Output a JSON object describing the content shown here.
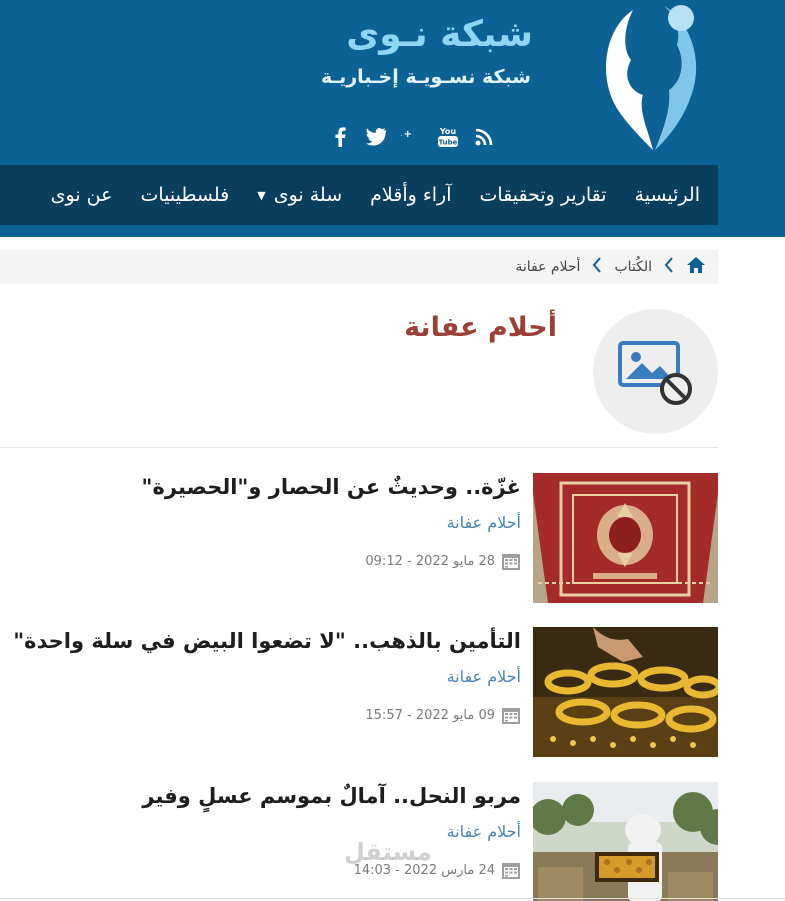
{
  "header": {
    "brand_title": "شبكة نـوى",
    "brand_subtitle": "شبكة نسـويـة إخـباريـة",
    "social": [
      {
        "icon": "rss-icon"
      },
      {
        "icon": "youtube-icon",
        "label": "You Tube"
      },
      {
        "icon": "google-plus-icon",
        "label": "g+"
      },
      {
        "icon": "twitter-icon"
      },
      {
        "icon": "facebook-icon",
        "label": "f"
      }
    ]
  },
  "nav": {
    "items": [
      "الرئيسية",
      "تقارير وتحقيقات",
      "آراء وأقلام",
      "سلة نوى",
      "فلسطينيات",
      "عن نوى"
    ]
  },
  "breadcrumb": {
    "level1": "الكُتاب",
    "level2": "أحلام عفانة"
  },
  "author": {
    "name": "أحلام عفانة"
  },
  "articles": [
    {
      "title": "غزّة.. وحديثٌ عن الحصار و\"الحصيرة\"",
      "author": "أحلام عفانة",
      "date": "28 مايو 2022 - 09:12"
    },
    {
      "title": "التأمين بالذهب.. \"لا تضعوا البيض في سلة واحدة\"",
      "author": "أحلام عفانة",
      "date": "09 مايو 2022 - 15:57"
    },
    {
      "title": "مربو النحل.. آمالٌ بموسم عسلٍ وفير",
      "author": "أحلام عفانة",
      "date": "24 مارس 2022 - 14:03"
    }
  ],
  "watermark": "مستقل",
  "colors": {
    "header_bg": "#0c6294",
    "nav_bg": "#0a3e5e",
    "author_name": "#9a4035",
    "link": "#4a85b8"
  }
}
